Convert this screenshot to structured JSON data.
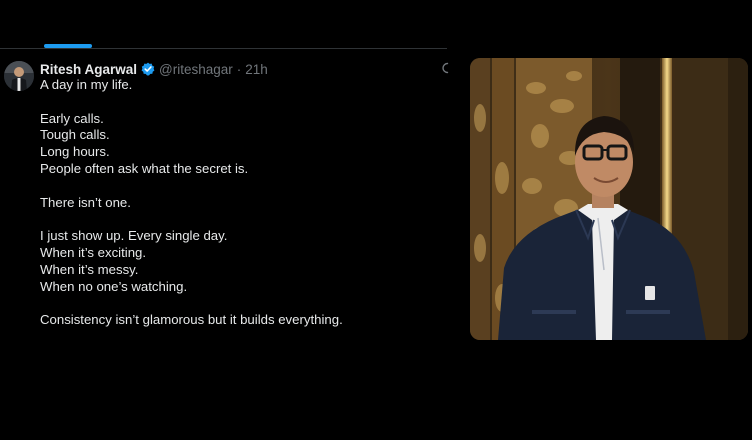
{
  "post": {
    "display_name": "Ritesh Agarwal",
    "handle": "@riteshagar",
    "separator": "·",
    "time": "21h",
    "lines": [
      "A day in my life.",
      "",
      "Early calls.",
      "Tough calls.",
      "Long hours.",
      "People often ask what the secret is.",
      "",
      "There isn’t one.",
      "",
      "I just show up. Every single day.",
      "When it’s exciting.",
      "When it’s messy.",
      "When no one’s watching.",
      "",
      "Consistency isn’t glamorous but it builds everything."
    ]
  },
  "icons": {
    "verified": "verified-badge-icon",
    "more": "more-icon"
  },
  "colors": {
    "background": "#000000",
    "text": "#e7e9ea",
    "muted": "#71767b",
    "accent": "#1d9bf0",
    "divider": "#2f3336"
  }
}
